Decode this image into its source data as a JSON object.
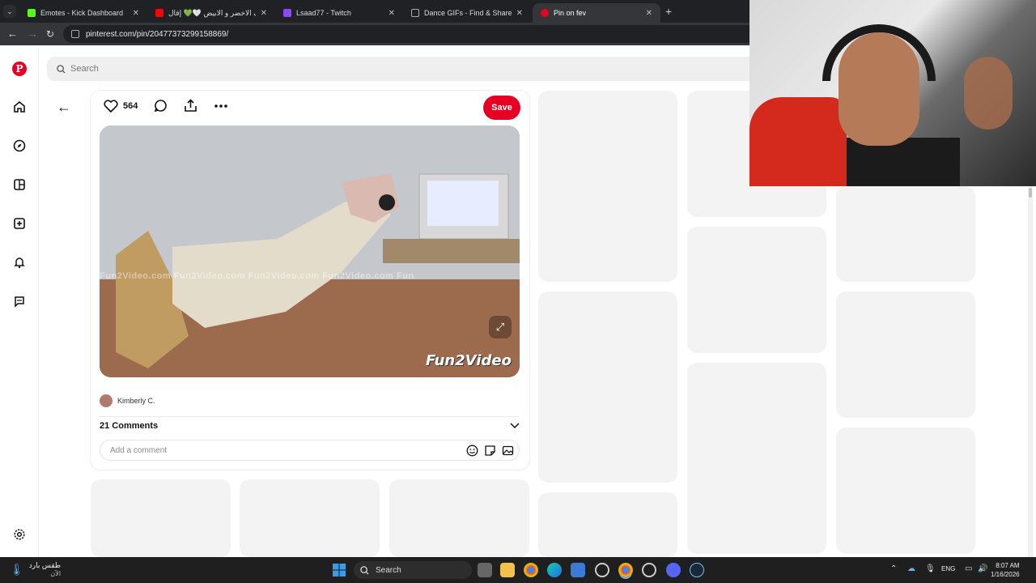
{
  "browser": {
    "tabs": [
      {
        "label": "Emotes - Kick Dashboard",
        "icon": "kick-icon",
        "color": "#53fc18"
      },
      {
        "label": "زقرف الاخضر و الابيض 🤍💚 إقال",
        "icon": "youtube-icon",
        "color": "#ff0000"
      },
      {
        "label": "Lsaad77 - Twitch",
        "icon": "twitch-icon",
        "color": "#9146ff"
      },
      {
        "label": "Dance GIFs - Find & Share on G",
        "icon": "giphy-icon",
        "color": "#8a8a8a"
      },
      {
        "label": "Pin on fev",
        "icon": "pinterest-icon",
        "color": "#e60023"
      }
    ],
    "url": "pinterest.com/pin/20477373299158869/"
  },
  "pinterest": {
    "search_placeholder": "Search",
    "rail_icons": [
      "home-icon",
      "explore-icon",
      "boards-icon",
      "create-icon",
      "notifications-icon",
      "messages-icon",
      "settings-icon"
    ],
    "pin": {
      "like_count": "564",
      "save_label": "Save",
      "watermark_text": "Fun2Video.com   Fun2Video.com   Fun2Video.com   Fun2Video.com   Fun",
      "watermark_logo": "Fun2Video",
      "author": "Kimberly C.",
      "comments_header": "21 Comments",
      "comment_placeholder": "Add a comment"
    }
  },
  "taskbar": {
    "weather_line1": "طقس بارد",
    "weather_line2": "الآن",
    "search_label": "Search",
    "lang": "ENG",
    "time": "8:07 AM",
    "date": "1/16/2026"
  }
}
